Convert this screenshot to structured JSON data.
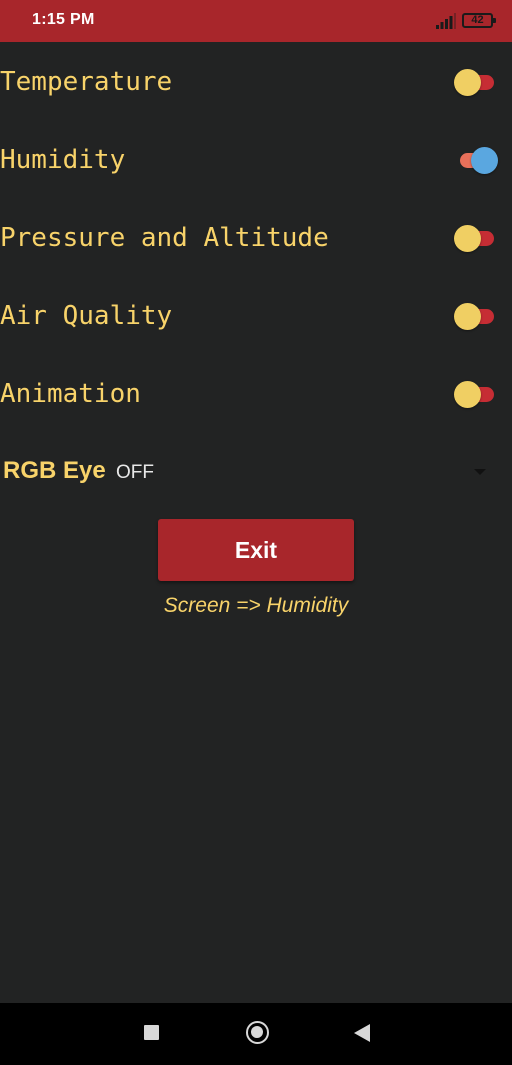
{
  "status_bar": {
    "time": "1:15 PM",
    "battery": "42",
    "signal_icon": "signal-icon",
    "color": "#a8262b"
  },
  "settings": [
    {
      "label": "Temperature",
      "enabled": false
    },
    {
      "label": "Humidity",
      "enabled": true
    },
    {
      "label": "Pressure and Altitude",
      "enabled": false
    },
    {
      "label": "Air Quality",
      "enabled": false
    },
    {
      "label": "Animation",
      "enabled": false
    }
  ],
  "rgb_eye": {
    "label": "RGB Eye",
    "selected": "OFF"
  },
  "exit_button": "Exit",
  "screen_status": "Screen => Humidity",
  "colors": {
    "background": "#222323",
    "accent_text": "#f8d36a",
    "toggle_off_thumb": "#f0cf63",
    "toggle_off_track": "#c62d34",
    "toggle_on_thumb": "#5aa7e0",
    "toggle_on_track": "#e8705a"
  },
  "nav_bar": {
    "icons": [
      "square-recents-icon",
      "circle-home-icon",
      "triangle-back-icon"
    ]
  }
}
